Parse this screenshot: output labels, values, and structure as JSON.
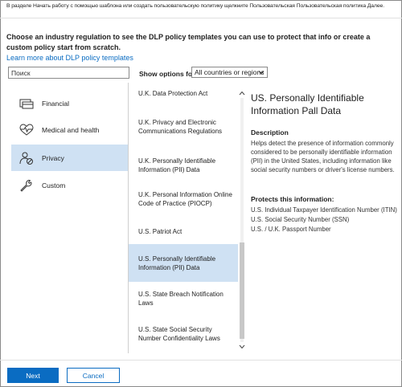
{
  "top_note": "В разделе Начать работу с помощью шаблона или создать пользовательскую политику щелкните Пользовательская Пользовательская политика Далее.",
  "intro": "Choose an industry regulation to see the DLP policy templates you can use to protect that info or create a custom policy start from scratch.",
  "learn_link": "Learn more about DLP policy templates",
  "search": {
    "value": "Поиск"
  },
  "filter": {
    "label": "Show options for",
    "selected": "All countries or regions"
  },
  "categories": [
    {
      "label": "Financial",
      "icon": "credit-card-icon"
    },
    {
      "label": "Medical and health",
      "icon": "heart-pulse-icon"
    },
    {
      "label": "Privacy",
      "icon": "person-privacy-icon",
      "selected": true
    },
    {
      "label": "Custom",
      "icon": "wrench-icon"
    }
  ],
  "templates": [
    {
      "label": "U.K. Data Protection Act"
    },
    {
      "label": "U.K. Privacy and Electronic Communications Regulations"
    },
    {
      "label": "U.K. Personally Identifiable Information (PII) Data"
    },
    {
      "label": "U.K. Personal Information Online Code of Practice (PIOCP)"
    },
    {
      "label": "U.S. Patriot Act"
    },
    {
      "label": "U.S. Personally Identifiable Information (PII) Data",
      "selected": true
    },
    {
      "label": "U.S. State Breach Notification Laws"
    },
    {
      "label": "U.S. State Social Security Number Confidentiality Laws"
    }
  ],
  "detail": {
    "title": "US. Personally Identifiable Information Pall Data",
    "description_heading": "Description",
    "description": "Helps detect the presence of information commonly considered to be personally identifiable information (PII) in the United States, including information like social security numbers or driver's license numbers.",
    "protects_heading": "Protects this information:",
    "protects": [
      "U.S. Individual Taxpayer Identification Number (ITIN)",
      "U.S. Social Security Number (SSN)",
      "U.S. / U.K. Passport Number"
    ]
  },
  "buttons": {
    "next": "Next",
    "cancel": "Cancel"
  },
  "colors": {
    "accent": "#0a6cc2",
    "selected_bg": "#cfe1f3"
  }
}
